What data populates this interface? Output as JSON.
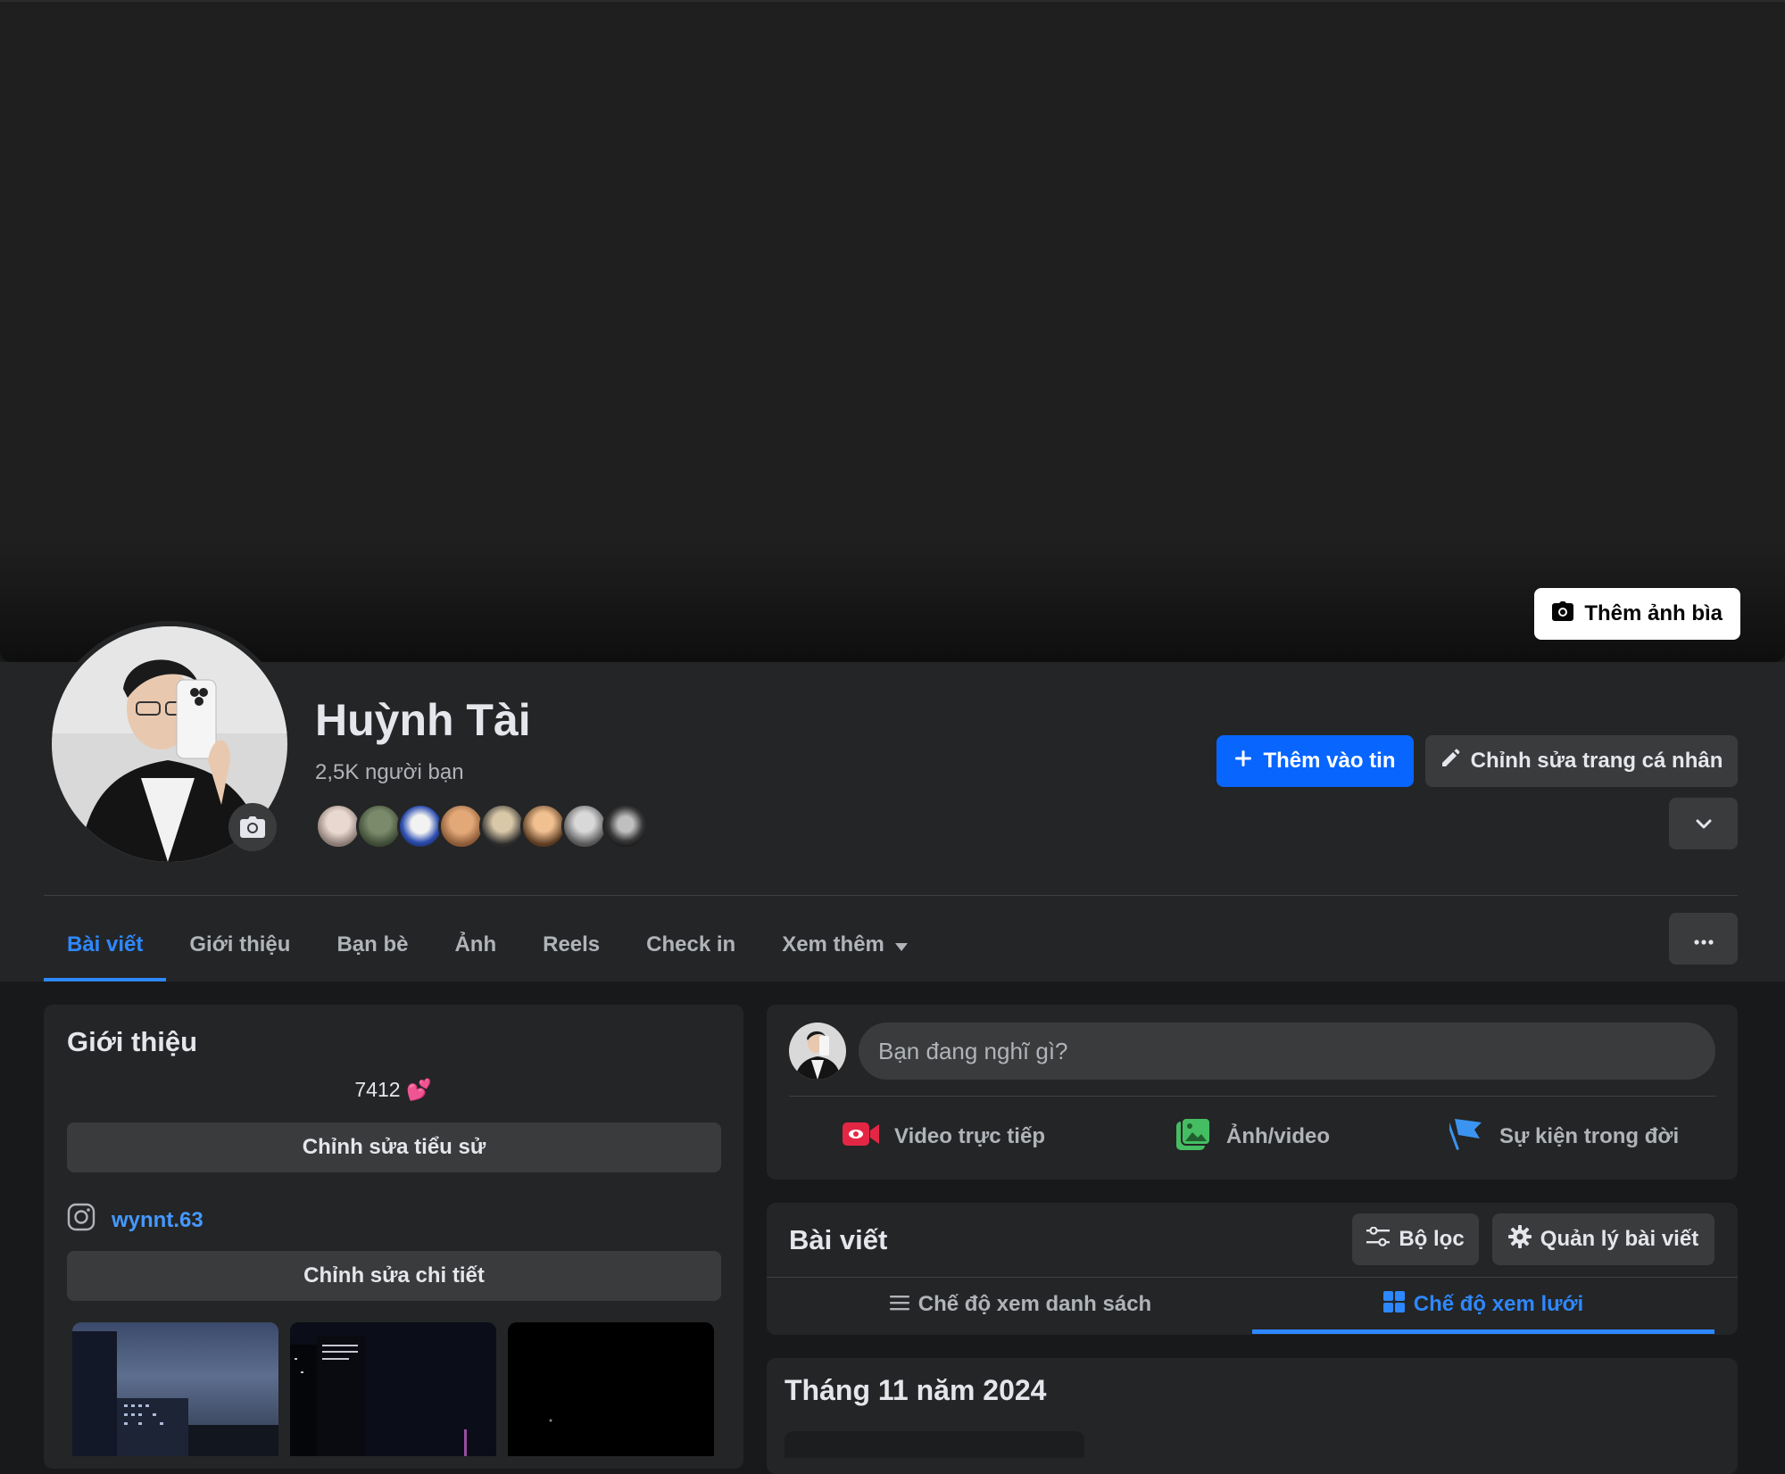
{
  "cover": {
    "add_cover_label": "Thêm ảnh bìa"
  },
  "profile": {
    "name": "Huỳnh Tài",
    "friends_count": "2,5K người bạn"
  },
  "actions": {
    "add_story": "Thêm vào tin",
    "edit_profile": "Chỉnh sửa trang cá nhân"
  },
  "tabs": [
    "Bài viết",
    "Giới thiệu",
    "Bạn bè",
    "Ảnh",
    "Reels",
    "Check in",
    "Xem thêm"
  ],
  "intro": {
    "title": "Giới thiệu",
    "bio": "7412 💕",
    "edit_bio": "Chỉnh sửa tiểu sử",
    "instagram": "wynnt.63",
    "edit_details": "Chỉnh sửa chi tiết"
  },
  "composer": {
    "placeholder": "Bạn đang nghĩ gì?",
    "live_video": "Video trực tiếp",
    "photo_video": "Ảnh/video",
    "life_event": "Sự kiện trong đời"
  },
  "posts": {
    "title": "Bài viết",
    "filter": "Bộ lọc",
    "manage": "Quản lý bài viết",
    "list_view": "Chế độ xem danh sách",
    "grid_view": "Chế độ xem lưới",
    "month_heading": "Tháng 11 năm 2024"
  },
  "colors": {
    "accent": "#0866ff",
    "link": "#2d88ff",
    "card": "#242526",
    "background": "#18191a"
  }
}
